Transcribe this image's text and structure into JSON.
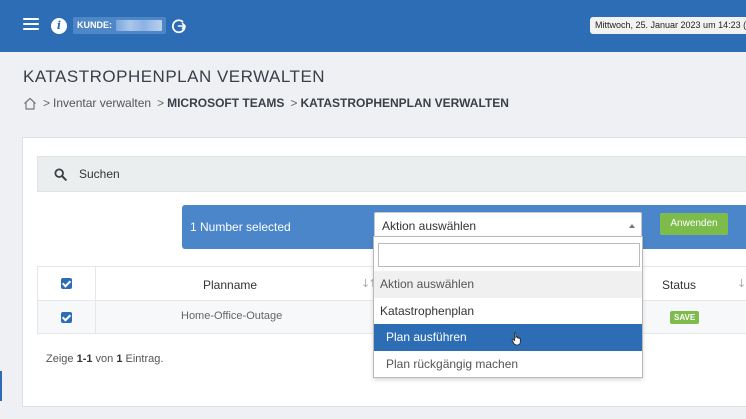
{
  "header": {
    "kunde_label": "KUNDE:",
    "datetime": "Mittwoch, 25. Januar 2023 um 14:23 (",
    "icons": [
      "menu-icon",
      "info-icon",
      "logout-icon"
    ],
    "background": "#2d6db5"
  },
  "page": {
    "title": "KATASTROPHENPLAN VERWALTEN",
    "breadcrumb": [
      "Inventar verwalten",
      "MICROSOFT TEAMS",
      "KATASTROPHENPLAN VERWALTEN"
    ]
  },
  "search": {
    "label": "Suchen"
  },
  "bulk": {
    "selected_label": "1 Number selected",
    "select_value": "Aktion auswählen",
    "apply_label": "Anwenden"
  },
  "dropdown": {
    "search_value": "",
    "placeholder_item": "Aktion auswählen",
    "group_label": "Katastrophenplan",
    "options": [
      "Plan ausführen",
      "Plan rückgängig machen"
    ],
    "highlighted": "Plan ausführen"
  },
  "table": {
    "columns": [
      "Planname",
      "Status"
    ],
    "rows": [
      {
        "checked": true,
        "planname": "Home-Office-Outage",
        "status": "SAVE"
      }
    ],
    "header_checked": true
  },
  "footer": {
    "prefix": "Zeige ",
    "range": "1-1",
    "middle": " von ",
    "count": "1",
    "suffix": " Eintrag."
  }
}
